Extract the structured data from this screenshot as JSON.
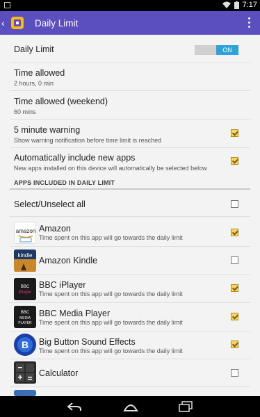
{
  "status_bar": {
    "time": "7:17"
  },
  "action_bar": {
    "title": "Daily Limit"
  },
  "settings": {
    "daily_limit": {
      "label": "Daily Limit",
      "toggle": "ON"
    },
    "time_allowed": {
      "label": "Time allowed",
      "value": "2 hours, 0 min"
    },
    "time_allowed_weekend": {
      "label": "Time allowed (weekend)",
      "value": "60 mins"
    },
    "warning": {
      "label": "5 minute warning",
      "desc": "Show warning notification before time limit is reached",
      "checked": true
    },
    "auto_include": {
      "label": "Automatically include new apps",
      "desc": "New apps installed on this device will automatically be selected below",
      "checked": true
    }
  },
  "apps_section": {
    "header": "APPS INCLUDED IN DAILY LIMIT",
    "select_all_label": "Select/Unselect all",
    "select_all_checked": false,
    "apps": [
      {
        "name": "Amazon",
        "desc": "Time spent on this app will go towards the daily limit",
        "checked": true,
        "icon": "amazon-icon",
        "icon_text": "amazon"
      },
      {
        "name": "Amazon Kindle",
        "desc": "",
        "checked": false,
        "icon": "kindle-icon",
        "icon_text": "kindle"
      },
      {
        "name": "BBC iPlayer",
        "desc": "Time spent on this app will go towards the daily limit",
        "checked": true,
        "icon": "bbc-iplayer-icon",
        "icon_text": "BBC iPlayer"
      },
      {
        "name": "BBC Media Player",
        "desc": "Time spent on this app will go towards the daily limit",
        "checked": true,
        "icon": "bbc-media-player-icon",
        "icon_text": "BBC MEDIA PLAYER"
      },
      {
        "name": "Big Button Sound Effects",
        "desc": "Time spent on this app will go towards the daily limit",
        "checked": true,
        "icon": "big-button-icon",
        "icon_text": "B"
      },
      {
        "name": "Calculator",
        "desc": "",
        "checked": false,
        "icon": "calculator-icon",
        "icon_text": ""
      }
    ]
  },
  "colors": {
    "action_bar": "#5b4fc0",
    "toggle_on": "#2da3da",
    "checkbox_checked": "#f6d56c"
  }
}
